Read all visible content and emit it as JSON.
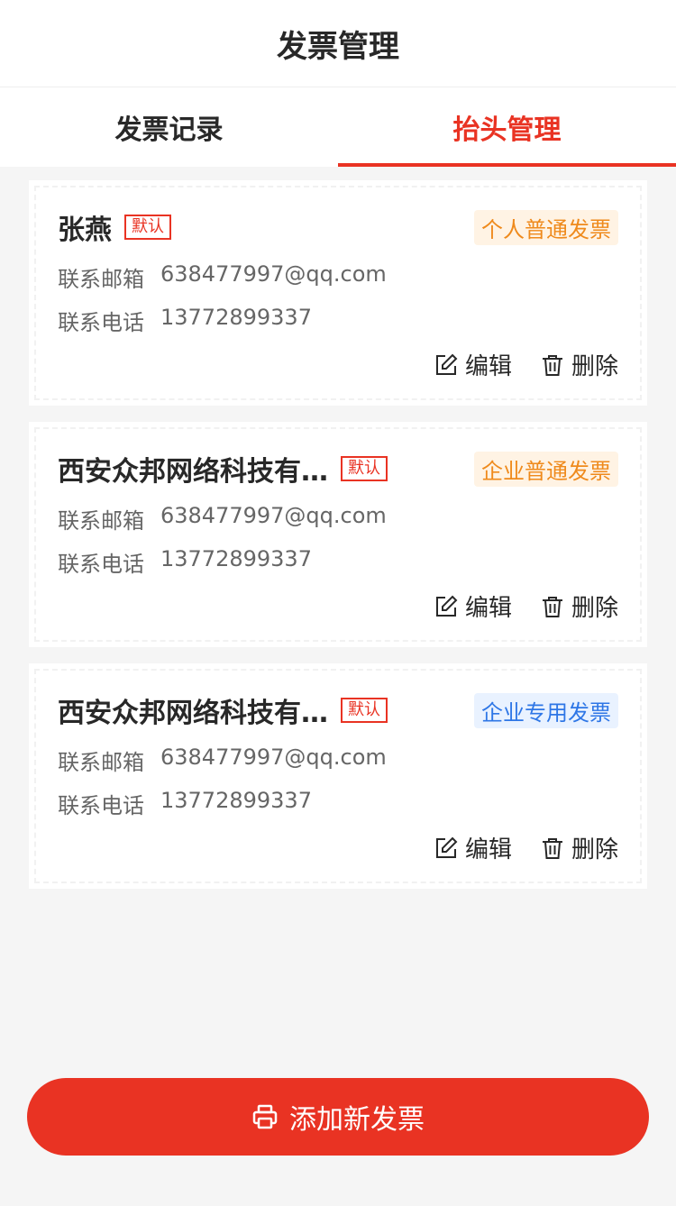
{
  "nav": {
    "title": "发票管理"
  },
  "tabs": [
    {
      "label": "发票记录",
      "active": false
    },
    {
      "label": "抬头管理",
      "active": true
    }
  ],
  "cards": [
    {
      "name": "张燕",
      "default_label": "默认",
      "type_label": "个人普通发票",
      "type_color": "orange",
      "email_label": "联系邮箱",
      "email_value": "638477997@qq.com",
      "phone_label": "联系电话",
      "phone_value": "13772899337",
      "edit_label": "编辑",
      "delete_label": "删除"
    },
    {
      "name": "西安众邦网络科技有…",
      "default_label": "默认",
      "type_label": "企业普通发票",
      "type_color": "orange",
      "email_label": "联系邮箱",
      "email_value": "638477997@qq.com",
      "phone_label": "联系电话",
      "phone_value": "13772899337",
      "edit_label": "编辑",
      "delete_label": "删除"
    },
    {
      "name": "西安众邦网络科技有…",
      "default_label": "默认",
      "type_label": "企业专用发票",
      "type_color": "blue",
      "email_label": "联系邮箱",
      "email_value": "638477997@qq.com",
      "phone_label": "联系电话",
      "phone_value": "13772899337",
      "edit_label": "编辑",
      "delete_label": "删除"
    }
  ],
  "add_button": {
    "label": "添加新发票",
    "icon": "printer-icon"
  },
  "colors": {
    "accent": "#e93323",
    "orange_text": "#ef8a1c",
    "orange_bg": "#fff3e4",
    "blue_text": "#2e76e6",
    "blue_bg": "#e9f2ff"
  }
}
